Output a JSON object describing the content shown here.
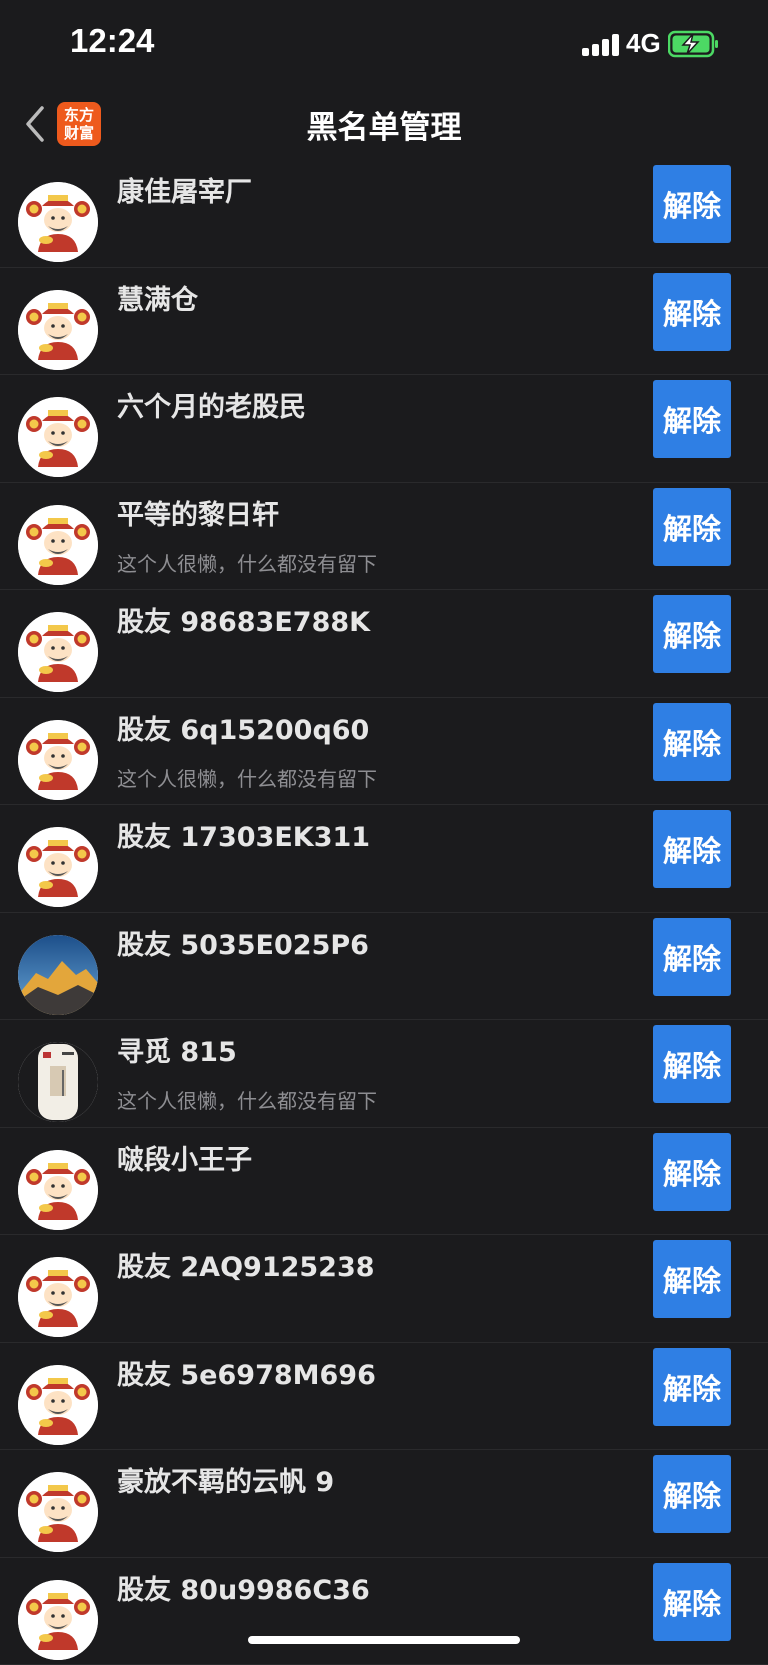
{
  "status": {
    "time": "12:24",
    "network": "4G"
  },
  "header": {
    "title": "黑名单管理",
    "logo_line1": "东方",
    "logo_line2": "财富"
  },
  "button_label": "解除",
  "rows": [
    {
      "name": "康佳屠宰厂",
      "signature": "",
      "avatar": "mascot"
    },
    {
      "name": "慧满仓",
      "signature": "",
      "avatar": "mascot"
    },
    {
      "name": "六个月的老股民",
      "signature": "",
      "avatar": "mascot"
    },
    {
      "name": "平等的黎日轩",
      "signature": "这个人很懒，什么都没有留下",
      "avatar": "mascot"
    },
    {
      "name": "股友 98683E788K",
      "signature": "",
      "avatar": "mascot"
    },
    {
      "name": "股友 6q15200q60",
      "signature": "这个人很懒，什么都没有留下",
      "avatar": "mascot"
    },
    {
      "name": "股友 17303EK311",
      "signature": "",
      "avatar": "mascot"
    },
    {
      "name": "股友 5035E025P6",
      "signature": "",
      "avatar": "mountain"
    },
    {
      "name": "寻觅 815",
      "signature": "这个人很懒，什么都没有留下",
      "avatar": "scroll"
    },
    {
      "name": "啵段小王子",
      "signature": "",
      "avatar": "mascot"
    },
    {
      "name": "股友 2AQ9125238",
      "signature": "",
      "avatar": "mascot"
    },
    {
      "name": "股友 5e6978M696",
      "signature": "",
      "avatar": "mascot"
    },
    {
      "name": "豪放不羁的云帆 9",
      "signature": "",
      "avatar": "mascot"
    },
    {
      "name": "股友 80u9986C36",
      "signature": "",
      "avatar": "mascot"
    }
  ],
  "colors": {
    "background": "#1b1b1d",
    "button": "#2f7fe4",
    "logo": "#ee5a1d",
    "battery": "#4cd964"
  }
}
